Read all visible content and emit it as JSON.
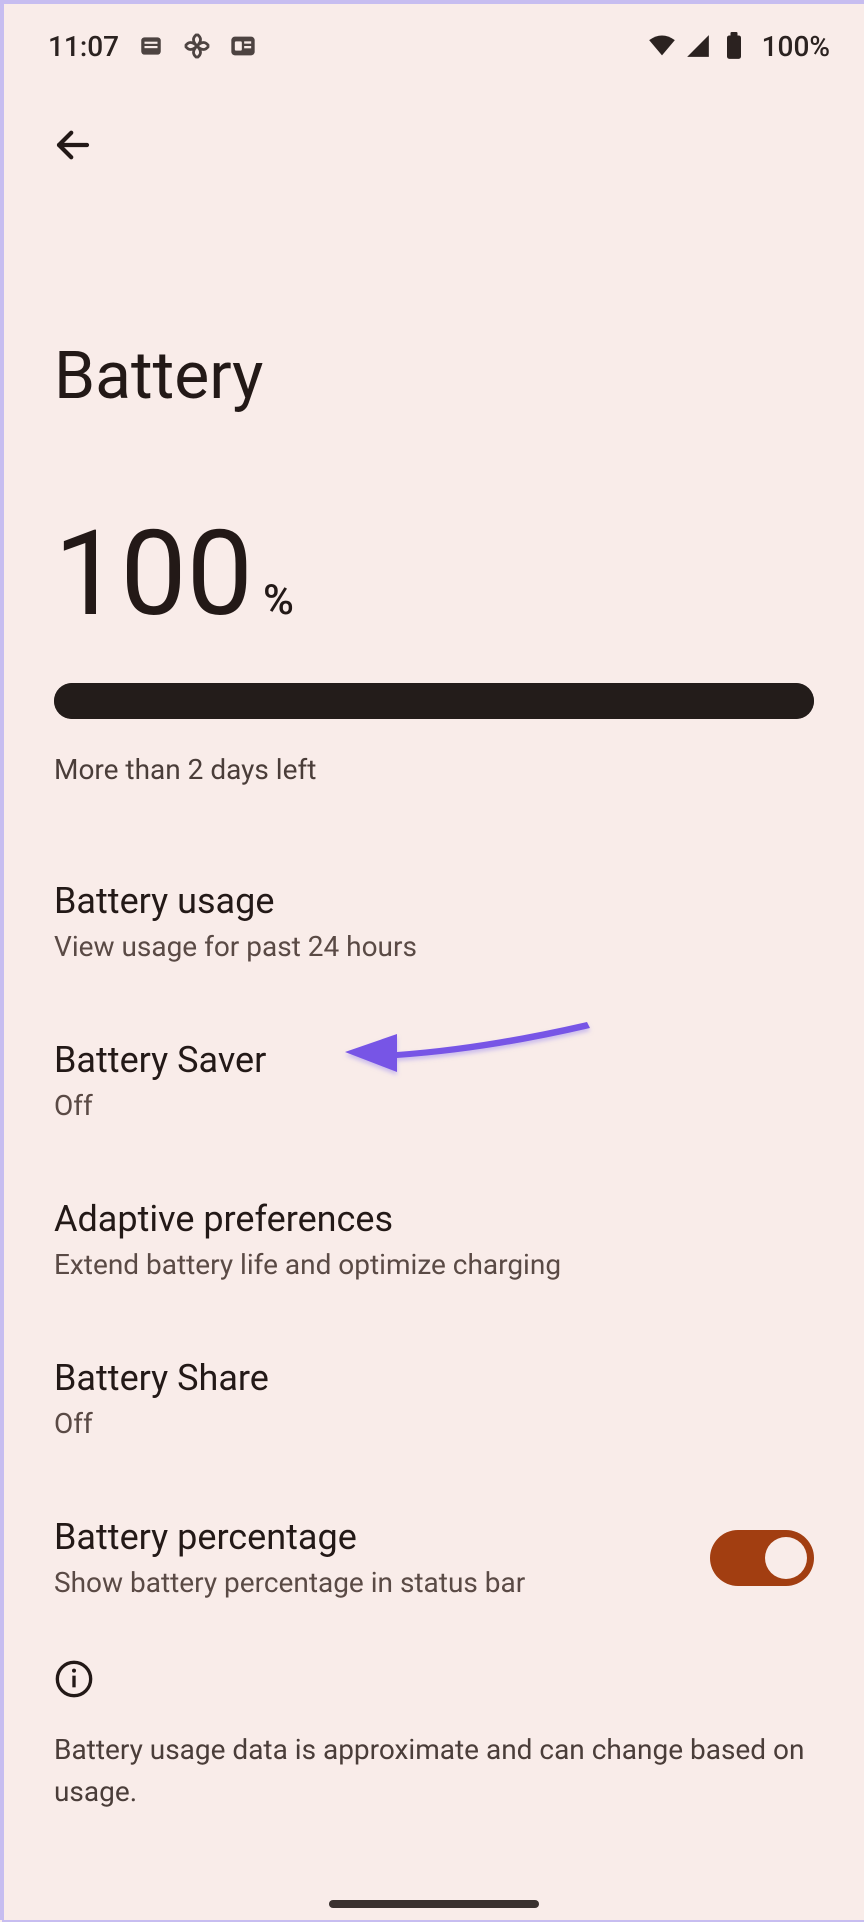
{
  "statusBar": {
    "time": "11:07",
    "batteryPercent": "100%"
  },
  "page": {
    "title": "Battery",
    "batteryLevel": "100",
    "percentSymbol": "%",
    "barFillPercent": 100,
    "estimate": "More than 2 days left"
  },
  "settings": {
    "usage": {
      "title": "Battery usage",
      "sub": "View usage for past 24 hours"
    },
    "saver": {
      "title": "Battery Saver",
      "sub": "Off"
    },
    "adaptive": {
      "title": "Adaptive preferences",
      "sub": "Extend battery life and optimize charging"
    },
    "share": {
      "title": "Battery Share",
      "sub": "Off"
    },
    "percentage": {
      "title": "Battery percentage",
      "sub": "Show battery percentage in status bar",
      "toggle": true
    }
  },
  "info": {
    "text": "Battery usage data is approximate and can change based on usage."
  },
  "colors": {
    "accent": "#a23e11",
    "arrow": "#7754e6"
  }
}
